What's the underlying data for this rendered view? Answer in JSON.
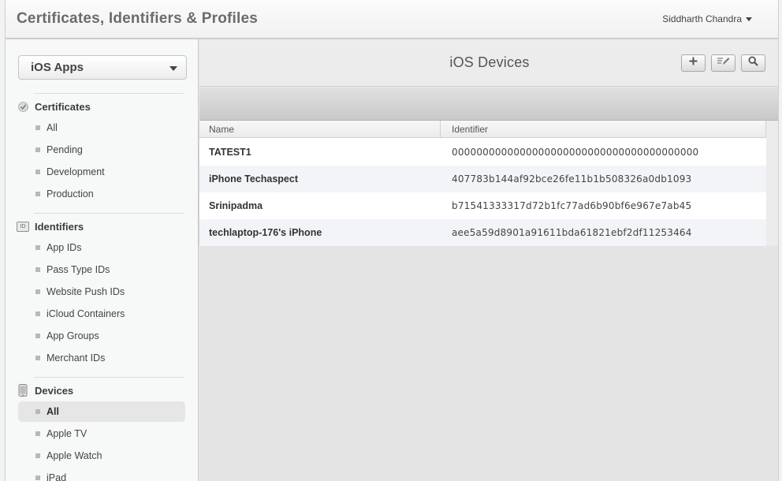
{
  "header": {
    "app_title": "Certificates, Identifiers & Profiles",
    "user_name": "Siddharth Chandra"
  },
  "sidebar": {
    "platform_select": "iOS Apps",
    "sections": {
      "certificates": {
        "title": "Certificates",
        "items": [
          "All",
          "Pending",
          "Development",
          "Production"
        ]
      },
      "identifiers": {
        "title": "Identifiers",
        "icon_text": "ID",
        "items": [
          "App IDs",
          "Pass Type IDs",
          "Website Push IDs",
          "iCloud Containers",
          "App Groups",
          "Merchant IDs"
        ]
      },
      "devices": {
        "title": "Devices",
        "items": [
          "All",
          "Apple TV",
          "Apple Watch",
          "iPad"
        ],
        "active_item": "All"
      }
    }
  },
  "main": {
    "title": "iOS Devices",
    "toolbar": {
      "add_icon": "plus-icon",
      "edit_icon": "edit-icon",
      "search_icon": "search-icon"
    },
    "table": {
      "columns": [
        "Name",
        "Identifier"
      ],
      "rows": [
        {
          "name": "TATEST1",
          "identifier": "0000000000000000000000000000000000000000"
        },
        {
          "name": "iPhone Techaspect",
          "identifier": "407783b144af92bce26fe11b1b508326a0db1093"
        },
        {
          "name": "Srinipadma",
          "identifier": "b71541333317d72b1fc77ad6b90bf6e967e7ab45"
        },
        {
          "name": "techlaptop-176's iPhone",
          "identifier": "aee5a59d8901a91611bda61821ebf2df11253464"
        }
      ]
    }
  }
}
